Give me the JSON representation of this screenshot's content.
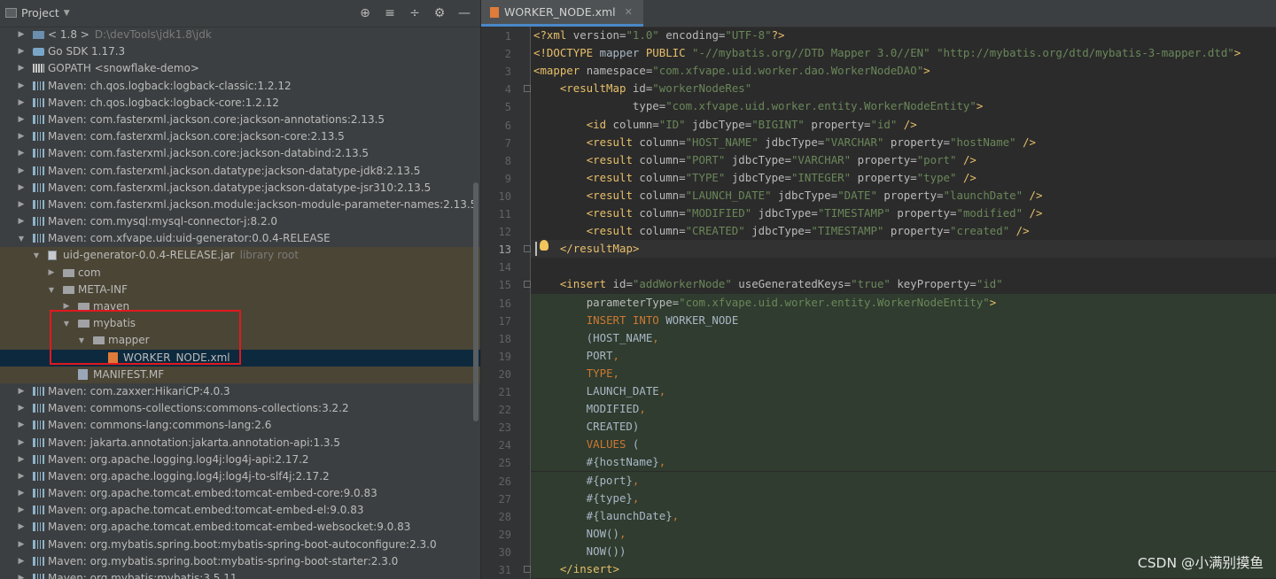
{
  "project_pane": {
    "title": "Project",
    "toolbar_icons": [
      "locate-icon",
      "expand-all-icon",
      "collapse-all-icon",
      "gear-icon",
      "minimize-icon"
    ],
    "rows": [
      {
        "indent": 1,
        "arrow": "right",
        "icon": "jdk",
        "label": "< 1.8 >",
        "sub": "D:\\devTools\\jdk1.8\\jdk"
      },
      {
        "indent": 1,
        "arrow": "right",
        "icon": "go",
        "label": "Go SDK 1.17.3",
        "sub": ""
      },
      {
        "indent": 1,
        "arrow": "right",
        "icon": "gopath",
        "label": "GOPATH <snowflake-demo>",
        "sub": ""
      },
      {
        "indent": 1,
        "arrow": "right",
        "icon": "lib",
        "label": "Maven: ch.qos.logback:logback-classic:1.2.12",
        "sub": ""
      },
      {
        "indent": 1,
        "arrow": "right",
        "icon": "lib",
        "label": "Maven: ch.qos.logback:logback-core:1.2.12",
        "sub": ""
      },
      {
        "indent": 1,
        "arrow": "right",
        "icon": "lib",
        "label": "Maven: com.fasterxml.jackson.core:jackson-annotations:2.13.5",
        "sub": ""
      },
      {
        "indent": 1,
        "arrow": "right",
        "icon": "lib",
        "label": "Maven: com.fasterxml.jackson.core:jackson-core:2.13.5",
        "sub": ""
      },
      {
        "indent": 1,
        "arrow": "right",
        "icon": "lib",
        "label": "Maven: com.fasterxml.jackson.core:jackson-databind:2.13.5",
        "sub": ""
      },
      {
        "indent": 1,
        "arrow": "right",
        "icon": "lib",
        "label": "Maven: com.fasterxml.jackson.datatype:jackson-datatype-jdk8:2.13.5",
        "sub": ""
      },
      {
        "indent": 1,
        "arrow": "right",
        "icon": "lib",
        "label": "Maven: com.fasterxml.jackson.datatype:jackson-datatype-jsr310:2.13.5",
        "sub": ""
      },
      {
        "indent": 1,
        "arrow": "right",
        "icon": "lib",
        "label": "Maven: com.fasterxml.jackson.module:jackson-module-parameter-names:2.13.5",
        "sub": ""
      },
      {
        "indent": 1,
        "arrow": "right",
        "icon": "lib",
        "label": "Maven: com.mysql:mysql-connector-j:8.2.0",
        "sub": ""
      },
      {
        "indent": 1,
        "arrow": "down",
        "icon": "lib",
        "label": "Maven: com.xfvape.uid:uid-generator:0.0.4-RELEASE",
        "sub": ""
      },
      {
        "indent": 2,
        "arrow": "down",
        "icon": "jar",
        "label": "uid-generator-0.0.4-RELEASE.jar",
        "sub": "library root",
        "style": "lib"
      },
      {
        "indent": 3,
        "arrow": "right",
        "icon": "folder",
        "label": "com",
        "sub": "",
        "style": "lib"
      },
      {
        "indent": 3,
        "arrow": "down",
        "icon": "folder",
        "label": "META-INF",
        "sub": "",
        "style": "lib"
      },
      {
        "indent": 4,
        "arrow": "right",
        "icon": "folder",
        "label": "maven",
        "sub": "",
        "style": "lib"
      },
      {
        "indent": 4,
        "arrow": "down",
        "icon": "folder",
        "label": "mybatis",
        "sub": "",
        "style": "lib"
      },
      {
        "indent": 5,
        "arrow": "down",
        "icon": "folder",
        "label": "mapper",
        "sub": "",
        "style": "lib"
      },
      {
        "indent": 6,
        "arrow": "",
        "icon": "xml",
        "label": "WORKER_NODE.xml",
        "sub": "",
        "style": "sel"
      },
      {
        "indent": 4,
        "arrow": "",
        "icon": "mf",
        "label": "MANIFEST.MF",
        "sub": "",
        "style": "lib"
      },
      {
        "indent": 1,
        "arrow": "right",
        "icon": "lib",
        "label": "Maven: com.zaxxer:HikariCP:4.0.3",
        "sub": ""
      },
      {
        "indent": 1,
        "arrow": "right",
        "icon": "lib",
        "label": "Maven: commons-collections:commons-collections:3.2.2",
        "sub": ""
      },
      {
        "indent": 1,
        "arrow": "right",
        "icon": "lib",
        "label": "Maven: commons-lang:commons-lang:2.6",
        "sub": ""
      },
      {
        "indent": 1,
        "arrow": "right",
        "icon": "lib",
        "label": "Maven: jakarta.annotation:jakarta.annotation-api:1.3.5",
        "sub": ""
      },
      {
        "indent": 1,
        "arrow": "right",
        "icon": "lib",
        "label": "Maven: org.apache.logging.log4j:log4j-api:2.17.2",
        "sub": ""
      },
      {
        "indent": 1,
        "arrow": "right",
        "icon": "lib",
        "label": "Maven: org.apache.logging.log4j:log4j-to-slf4j:2.17.2",
        "sub": ""
      },
      {
        "indent": 1,
        "arrow": "right",
        "icon": "lib",
        "label": "Maven: org.apache.tomcat.embed:tomcat-embed-core:9.0.83",
        "sub": ""
      },
      {
        "indent": 1,
        "arrow": "right",
        "icon": "lib",
        "label": "Maven: org.apache.tomcat.embed:tomcat-embed-el:9.0.83",
        "sub": ""
      },
      {
        "indent": 1,
        "arrow": "right",
        "icon": "lib",
        "label": "Maven: org.apache.tomcat.embed:tomcat-embed-websocket:9.0.83",
        "sub": ""
      },
      {
        "indent": 1,
        "arrow": "right",
        "icon": "lib",
        "label": "Maven: org.mybatis.spring.boot:mybatis-spring-boot-autoconfigure:2.3.0",
        "sub": ""
      },
      {
        "indent": 1,
        "arrow": "right",
        "icon": "lib",
        "label": "Maven: org.mybatis.spring.boot:mybatis-spring-boot-starter:2.3.0",
        "sub": ""
      },
      {
        "indent": 1,
        "arrow": "right",
        "icon": "lib",
        "label": "Maven: org.mybatis:mybatis:3.5.11",
        "sub": ""
      }
    ]
  },
  "editor": {
    "tab_label": "WORKER_NODE.xml",
    "current_line": 13,
    "lines": [
      [
        [
          "pre",
          "<?xml "
        ],
        [
          "attr",
          "version="
        ],
        [
          "val",
          "\"1.0\""
        ],
        [
          "attr",
          " encoding="
        ],
        [
          "val",
          "\"UTF-8\""
        ],
        [
          "pre",
          "?>"
        ]
      ],
      [
        [
          "pre",
          "<!DOCTYPE "
        ],
        [
          "txt",
          "mapper "
        ],
        [
          "pre",
          "PUBLIC "
        ],
        [
          "val",
          "\"-//mybatis.org//DTD Mapper 3.0//EN\""
        ],
        [
          "txt",
          " "
        ],
        [
          "val",
          "\"http://mybatis.org/dtd/mybatis-3-mapper.dtd\""
        ],
        [
          "pre",
          ">"
        ]
      ],
      [
        [
          "tag",
          "<mapper "
        ],
        [
          "attr",
          "namespace="
        ],
        [
          "val",
          "\"com.xfvape.uid.worker.dao.WorkerNodeDAO\""
        ],
        [
          "tag",
          ">"
        ]
      ],
      [
        [
          "txt",
          "    "
        ],
        [
          "tag",
          "<resultMap "
        ],
        [
          "attr",
          "id="
        ],
        [
          "val",
          "\"workerNodeRes\""
        ]
      ],
      [
        [
          "txt",
          "               "
        ],
        [
          "attr",
          "type="
        ],
        [
          "val",
          "\"com.xfvape.uid.worker.entity.WorkerNodeEntity\""
        ],
        [
          "tag",
          ">"
        ]
      ],
      [
        [
          "txt",
          "        "
        ],
        [
          "tag",
          "<id "
        ],
        [
          "attr",
          "column="
        ],
        [
          "val",
          "\"ID\""
        ],
        [
          "attr",
          " jdbcType="
        ],
        [
          "val",
          "\"BIGINT\""
        ],
        [
          "attr",
          " property="
        ],
        [
          "val",
          "\"id\""
        ],
        [
          "tag",
          " />"
        ]
      ],
      [
        [
          "txt",
          "        "
        ],
        [
          "tag",
          "<result "
        ],
        [
          "attr",
          "column="
        ],
        [
          "val",
          "\"HOST_NAME\""
        ],
        [
          "attr",
          " jdbcType="
        ],
        [
          "val",
          "\"VARCHAR\""
        ],
        [
          "attr",
          " property="
        ],
        [
          "val",
          "\"hostName\""
        ],
        [
          "tag",
          " />"
        ]
      ],
      [
        [
          "txt",
          "        "
        ],
        [
          "tag",
          "<result "
        ],
        [
          "attr",
          "column="
        ],
        [
          "val",
          "\"PORT\""
        ],
        [
          "attr",
          " jdbcType="
        ],
        [
          "val",
          "\"VARCHAR\""
        ],
        [
          "attr",
          " property="
        ],
        [
          "val",
          "\"port\""
        ],
        [
          "tag",
          " />"
        ]
      ],
      [
        [
          "txt",
          "        "
        ],
        [
          "tag",
          "<result "
        ],
        [
          "attr",
          "column="
        ],
        [
          "val",
          "\"TYPE\""
        ],
        [
          "attr",
          " jdbcType="
        ],
        [
          "val",
          "\"INTEGER\""
        ],
        [
          "attr",
          " property="
        ],
        [
          "val",
          "\"type\""
        ],
        [
          "tag",
          " />"
        ]
      ],
      [
        [
          "txt",
          "        "
        ],
        [
          "tag",
          "<result "
        ],
        [
          "attr",
          "column="
        ],
        [
          "val",
          "\"LAUNCH_DATE\""
        ],
        [
          "attr",
          " jdbcType="
        ],
        [
          "val",
          "\"DATE\""
        ],
        [
          "attr",
          " property="
        ],
        [
          "val",
          "\"launchDate\""
        ],
        [
          "tag",
          " />"
        ]
      ],
      [
        [
          "txt",
          "        "
        ],
        [
          "tag",
          "<result "
        ],
        [
          "attr",
          "column="
        ],
        [
          "val",
          "\"MODIFIED\""
        ],
        [
          "attr",
          " jdbcType="
        ],
        [
          "val",
          "\"TIMESTAMP\""
        ],
        [
          "attr",
          " property="
        ],
        [
          "val",
          "\"modified\""
        ],
        [
          "tag",
          " />"
        ]
      ],
      [
        [
          "txt",
          "        "
        ],
        [
          "tag",
          "<result "
        ],
        [
          "attr",
          "column="
        ],
        [
          "val",
          "\"CREATED\""
        ],
        [
          "attr",
          " jdbcType="
        ],
        [
          "val",
          "\"TIMESTAMP\""
        ],
        [
          "attr",
          " property="
        ],
        [
          "val",
          "\"created\""
        ],
        [
          "tag",
          " />"
        ]
      ],
      [
        [
          "txt",
          "    "
        ],
        [
          "tag",
          "</resultMap>"
        ]
      ],
      [],
      [
        [
          "txt",
          "    "
        ],
        [
          "tag",
          "<insert "
        ],
        [
          "attr",
          "id="
        ],
        [
          "val",
          "\"addWorkerNode\""
        ],
        [
          "attr",
          " useGeneratedKeys="
        ],
        [
          "val",
          "\"true\""
        ],
        [
          "attr",
          " keyProperty="
        ],
        [
          "val",
          "\"id\""
        ]
      ],
      [
        [
          "txt",
          "        "
        ],
        [
          "attr",
          "parameterType="
        ],
        [
          "val",
          "\"com.xfvape.uid.worker.entity.WorkerNodeEntity\""
        ],
        [
          "tag",
          ">"
        ]
      ],
      [
        [
          "txt",
          "        "
        ],
        [
          "kw",
          "INSERT INTO "
        ],
        [
          "txt",
          "WORKER_NODE"
        ]
      ],
      [
        [
          "txt",
          "        (HOST_NAME"
        ],
        [
          "kw",
          ","
        ]
      ],
      [
        [
          "txt",
          "        PORT"
        ],
        [
          "kw",
          ","
        ]
      ],
      [
        [
          "txt",
          "        "
        ],
        [
          "kw",
          "TYPE,"
        ]
      ],
      [
        [
          "txt",
          "        LAUNCH_DATE"
        ],
        [
          "kw",
          ","
        ]
      ],
      [
        [
          "txt",
          "        MODIFIED"
        ],
        [
          "kw",
          ","
        ]
      ],
      [
        [
          "txt",
          "        CREATED)"
        ]
      ],
      [
        [
          "txt",
          "        "
        ],
        [
          "kw",
          "VALUES "
        ],
        [
          "txt",
          "("
        ]
      ],
      [
        [
          "txt",
          "        #{hostName}"
        ],
        [
          "kw",
          ","
        ]
      ],
      [
        [
          "txt",
          "        #{port}"
        ],
        [
          "kw",
          ","
        ]
      ],
      [
        [
          "txt",
          "        #{type}"
        ],
        [
          "kw",
          ","
        ]
      ],
      [
        [
          "txt",
          "        #{launchDate}"
        ],
        [
          "kw",
          ","
        ]
      ],
      [
        [
          "txt",
          "        NOW()"
        ],
        [
          "kw",
          ","
        ]
      ],
      [
        [
          "txt",
          "        NOW())"
        ]
      ],
      [
        [
          "txt",
          "    "
        ],
        [
          "tag",
          "</insert>"
        ]
      ]
    ],
    "injected_lines": [
      16,
      17,
      18,
      19,
      20,
      21,
      22,
      23,
      24,
      25,
      26,
      27,
      28,
      29,
      30,
      31
    ],
    "fold_lines": [
      4,
      13,
      15,
      31
    ]
  },
  "watermark": "CSDN @小满别摸鱼",
  "colors": {
    "selection": "#0d293e",
    "library_root_row": "#4b4535",
    "highlight_box": "#e0191f",
    "tag": "#e8bf6a",
    "string": "#6a8759",
    "keyword": "#cc7832"
  }
}
